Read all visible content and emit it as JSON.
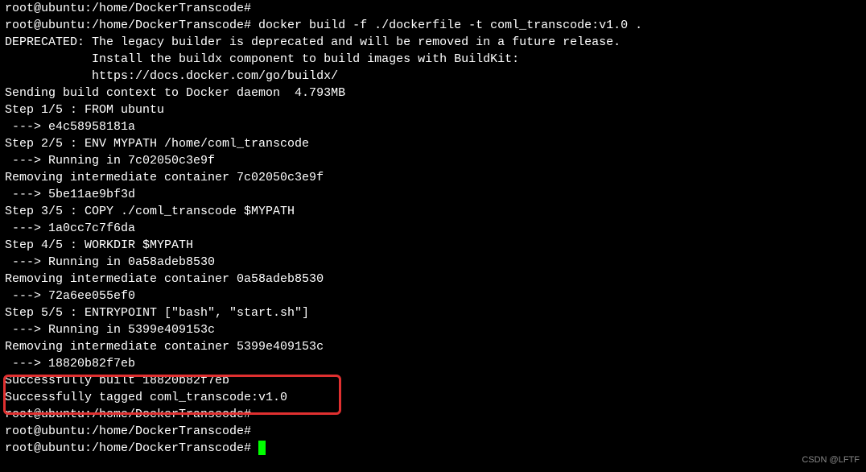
{
  "terminal": {
    "lines": [
      "root@ubuntu:/home/DockerTranscode#",
      "root@ubuntu:/home/DockerTranscode# docker build -f ./dockerfile -t coml_transcode:v1.0 .",
      "DEPRECATED: The legacy builder is deprecated and will be removed in a future release.",
      "            Install the buildx component to build images with BuildKit:",
      "            https://docs.docker.com/go/buildx/",
      "",
      "Sending build context to Docker daemon  4.793MB",
      "Step 1/5 : FROM ubuntu",
      " ---> e4c58958181a",
      "Step 2/5 : ENV MYPATH /home/coml_transcode",
      " ---> Running in 7c02050c3e9f",
      "Removing intermediate container 7c02050c3e9f",
      " ---> 5be11ae9bf3d",
      "Step 3/5 : COPY ./coml_transcode $MYPATH",
      " ---> 1a0cc7c7f6da",
      "Step 4/5 : WORKDIR $MYPATH",
      " ---> Running in 0a58adeb8530",
      "Removing intermediate container 0a58adeb8530",
      " ---> 72a6ee055ef0",
      "Step 5/5 : ENTRYPOINT [\"bash\", \"start.sh\"]",
      " ---> Running in 5399e409153c",
      "Removing intermediate container 5399e409153c",
      " ---> 18820b82f7eb",
      "Successfully built 18820b82f7eb",
      "Successfully tagged coml_transcode:v1.0",
      "root@ubuntu:/home/DockerTranscode#",
      "root@ubuntu:/home/DockerTranscode#"
    ],
    "final_prompt": "root@ubuntu:/home/DockerTranscode# "
  },
  "watermark": "CSDN @LFTF"
}
